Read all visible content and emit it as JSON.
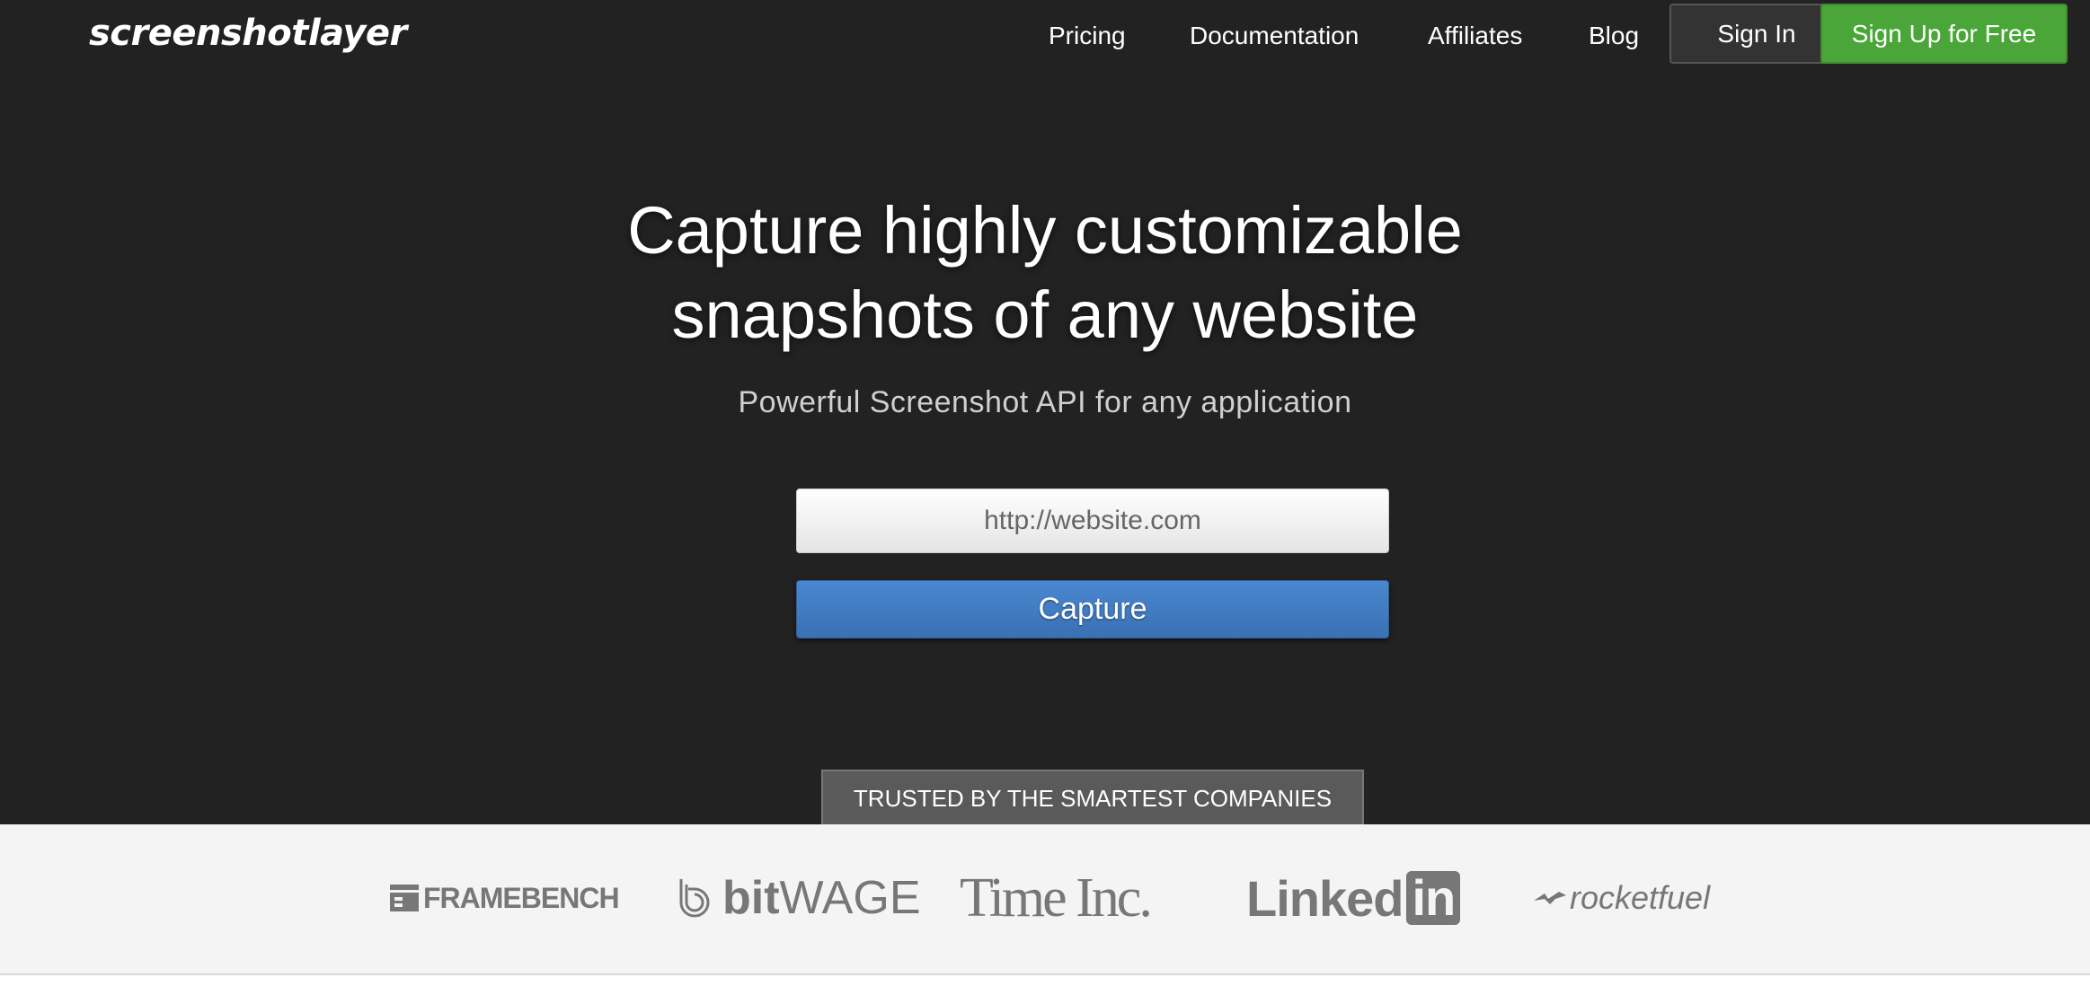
{
  "header": {
    "logo_text": "screenshotlayer",
    "nav": [
      {
        "label": "Pricing"
      },
      {
        "label": "Documentation"
      },
      {
        "label": "Affiliates"
      },
      {
        "label": "Blog"
      }
    ],
    "signin_label": "Sign In",
    "signup_label": "Sign Up for Free"
  },
  "hero": {
    "headline_line1": "Capture highly customizable",
    "headline_line2": "snapshots of any website",
    "subheadline": "Powerful Screenshot API for any application",
    "url_placeholder": "http://website.com",
    "capture_label": "Capture"
  },
  "trusted": {
    "label": "TRUSTED BY THE SMARTEST COMPANIES",
    "companies": [
      {
        "name": "FRAMEBENCH"
      },
      {
        "name": "bitWAGE",
        "parts": [
          "bit",
          "WAGE"
        ]
      },
      {
        "name": "Time Inc."
      },
      {
        "name": "Linkedin",
        "parts": [
          "Linked",
          "in"
        ]
      },
      {
        "name": "rocketfuel"
      }
    ]
  },
  "colors": {
    "hero_bg": "#222222",
    "signup_green": "#4aa638",
    "capture_blue": "#3f7cc4",
    "logos_bar_bg": "#f4f4f4",
    "logo_gray": "#777777"
  },
  "icons": [
    "framebench-logo-icon",
    "bitwage-logo-icon",
    "linkedin-in-icon",
    "rocketfuel-logo-icon"
  ]
}
